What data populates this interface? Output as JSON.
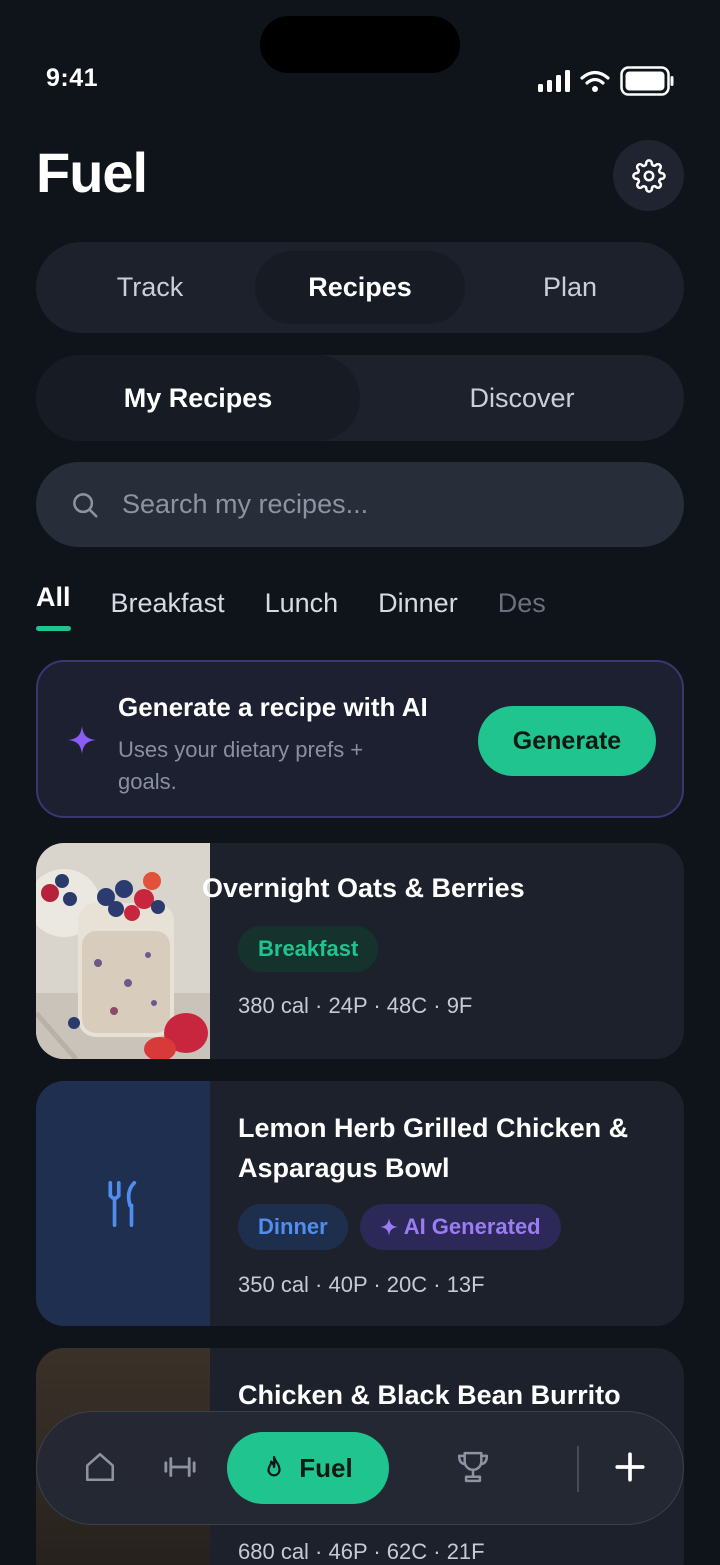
{
  "status": {
    "time": "9:41"
  },
  "header": {
    "title": "Fuel"
  },
  "main_tabs": [
    {
      "label": "Track",
      "active": false
    },
    {
      "label": "Recipes",
      "active": true
    },
    {
      "label": "Plan",
      "active": false
    }
  ],
  "sub_tabs": [
    {
      "label": "My Recipes",
      "active": true
    },
    {
      "label": "Discover",
      "active": false
    }
  ],
  "search": {
    "placeholder": "Search my recipes..."
  },
  "categories": [
    "All",
    "Breakfast",
    "Lunch",
    "Dinner",
    "Des"
  ],
  "ai_card": {
    "title": "Generate a recipe with AI",
    "subtitle": "Uses your dietary prefs + goals.",
    "button": "Generate"
  },
  "recipes": [
    {
      "title": "Overnight Oats & Berries",
      "tags": [
        "Breakfast"
      ],
      "macros": "380 cal · 24P · 48C · 9F"
    },
    {
      "title": "Lemon Herb Grilled Chicken & Asparagus Bowl",
      "tags": [
        "Dinner",
        "AI Generated"
      ],
      "macros": "350 cal · 40P · 20C · 13F"
    },
    {
      "title": "Chicken & Black Bean Burrito",
      "tags": [],
      "macros": "680 cal · 46P · 62C · 21F"
    }
  ],
  "bottom_nav": {
    "active_label": "Fuel"
  },
  "colors": {
    "accent": "#1fc48f",
    "background": "#0f131a",
    "card": "#1c212b",
    "ai_purple": "#9a7cf5",
    "dinner_blue": "#4f8ef0"
  }
}
